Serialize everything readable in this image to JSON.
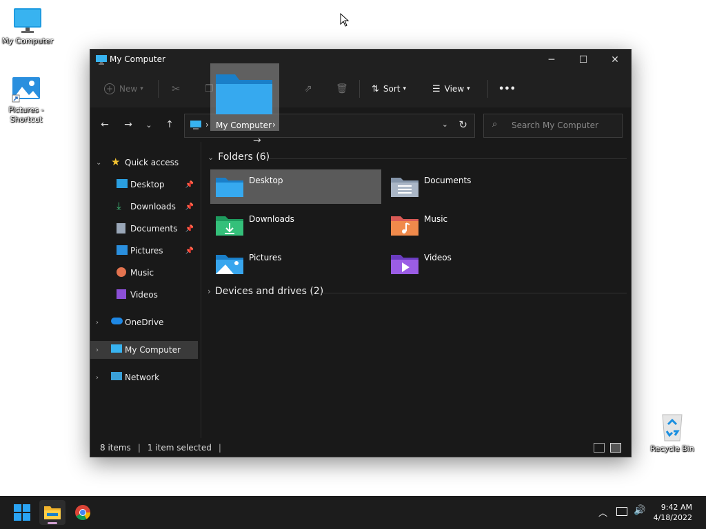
{
  "desktop": {
    "icons": [
      {
        "label": "My Computer",
        "icon": "monitor-icon"
      },
      {
        "label": "Pictures - Shortcut",
        "icon": "pictures-shortcut-icon"
      },
      {
        "label": "Recycle Bin",
        "icon": "recycle-bin-icon"
      }
    ]
  },
  "window": {
    "title": "My Computer",
    "controls": {
      "minimize": "─",
      "maximize": "☐",
      "close": "✕"
    }
  },
  "toolbar": {
    "new_label": "New",
    "sort_label": "Sort",
    "view_label": "View",
    "more_label": "•••"
  },
  "address": {
    "path_item": "My Computer",
    "search_placeholder": "Search My Computer"
  },
  "sidebar": {
    "quick_access": "Quick access",
    "items": [
      {
        "label": "Desktop",
        "pinned": true
      },
      {
        "label": "Downloads",
        "pinned": true
      },
      {
        "label": "Documents",
        "pinned": true
      },
      {
        "label": "Pictures",
        "pinned": true
      },
      {
        "label": "Music",
        "pinned": false
      },
      {
        "label": "Videos",
        "pinned": false
      }
    ],
    "onedrive": "OneDrive",
    "my_computer": "My Computer",
    "network": "Network"
  },
  "content": {
    "folders_header": "Folders (6)",
    "folders": [
      {
        "label": "Desktop",
        "selected": true
      },
      {
        "label": "Documents"
      },
      {
        "label": "Downloads"
      },
      {
        "label": "Music"
      },
      {
        "label": "Pictures"
      },
      {
        "label": "Videos"
      }
    ],
    "devices_header": "Devices and drives (2)"
  },
  "status": {
    "items": "8 items",
    "selected": "1 item selected"
  },
  "drag": {
    "label": "My Computer"
  },
  "taskbar": {
    "time": "9:42 AM",
    "date": "4/18/2022"
  },
  "colors": {
    "accent": "#0078d4",
    "window_bg": "#191919",
    "selected_tile": "#5a5a5a"
  }
}
